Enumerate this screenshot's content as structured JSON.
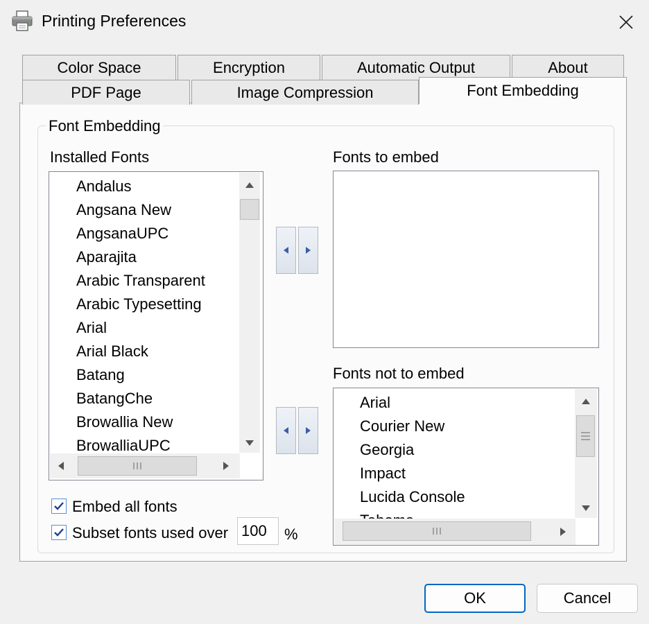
{
  "window": {
    "title": "Printing Preferences",
    "close_icon": "close-icon",
    "app_icon": "printer-icon"
  },
  "tabs": {
    "row_back": [
      "Color Space",
      "Encryption",
      "Automatic Output",
      "About"
    ],
    "row_front": [
      "PDF Page",
      "Image Compression",
      "Font Embedding"
    ],
    "active": "Font Embedding"
  },
  "group": {
    "title": "Font Embedding",
    "installed_label": "Installed Fonts",
    "installed_fonts": [
      "Andalus",
      "Angsana New",
      "AngsanaUPC",
      "Aparajita",
      "Arabic Transparent",
      "Arabic Typesetting",
      "Arial",
      "Arial Black",
      "Batang",
      "BatangChe",
      "Browallia New",
      "BrowalliaUPC"
    ],
    "embed_label": "Fonts to embed",
    "embed_fonts": [],
    "not_embed_label": "Fonts not to embed",
    "not_embed_fonts": [
      "Arial",
      "Courier New",
      "Georgia",
      "Impact",
      "Lucida Console",
      "Tahoma"
    ]
  },
  "options": {
    "embed_all_label": "Embed all fonts",
    "embed_all_checked": true,
    "subset_label": "Subset fonts used over",
    "subset_checked": true,
    "subset_value": "100",
    "subset_unit": "%"
  },
  "buttons": {
    "ok": "OK",
    "cancel": "Cancel"
  },
  "colors": {
    "accent": "#0067c0",
    "checkbox_border": "#5a8ed6"
  }
}
